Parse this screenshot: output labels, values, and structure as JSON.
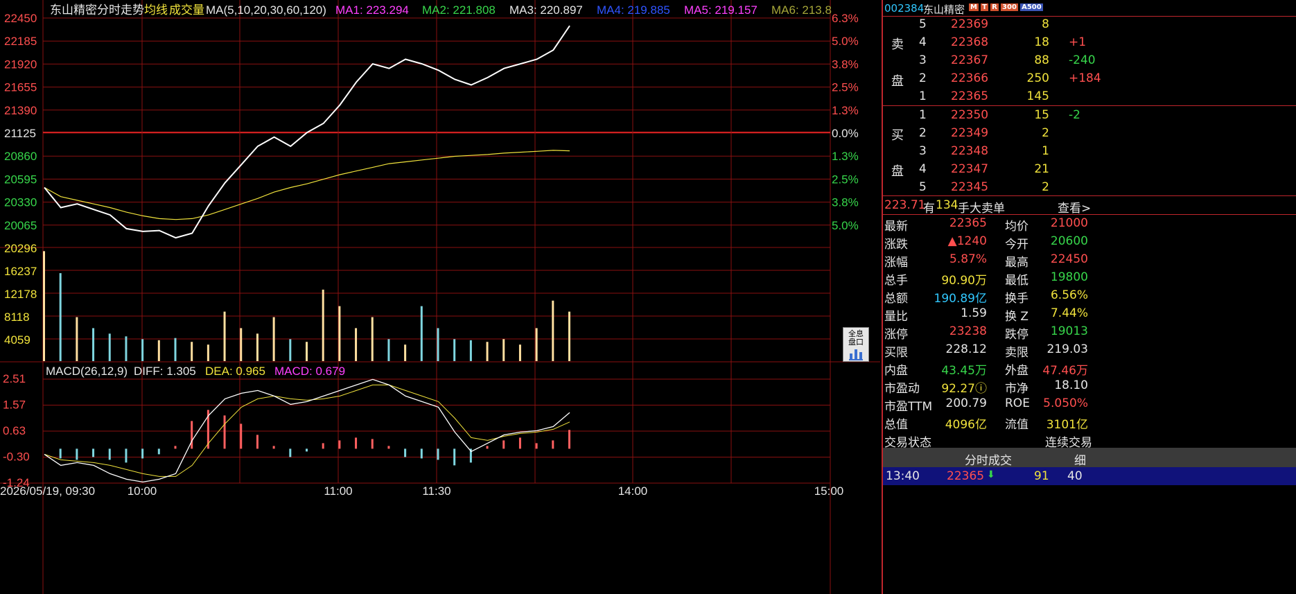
{
  "chart": {
    "title": "东山精密分时走势",
    "mode_avg": "均线",
    "mode_vol": "成交量",
    "ma_label": "MA(5,10,20,30,60,120)",
    "ma1": "MA1: 223.294",
    "ma2": "MA2: 221.808",
    "ma3": "MA3: 220.897",
    "ma4": "MA4: 219.885",
    "ma5": "MA5: 219.157",
    "ma6": "MA6: 213.8",
    "price_ticks": [
      "22450",
      "22185",
      "21920",
      "21655",
      "21390",
      "21125",
      "20860",
      "20595",
      "20330",
      "20065"
    ],
    "pct_ticks": [
      "6.3%",
      "5.0%",
      "3.8%",
      "2.5%",
      "1.3%",
      "0.0%",
      "1.3%",
      "2.5%",
      "3.8%",
      "5.0%"
    ],
    "vol_ticks": [
      "20296",
      "16237",
      "12178",
      "8118",
      "4059"
    ],
    "macd_label": "MACD(26,12,9)",
    "diff": "DIFF: 1.305",
    "dea": "DEA: 0.965",
    "macd": "MACD: 0.679",
    "macd_ticks": [
      "2.51",
      "1.57",
      "0.63",
      "-0.30",
      "-1.24"
    ],
    "date": "2026/05/19, 09:30",
    "time_ticks": [
      "10:00",
      "11:00",
      "11:30",
      "14:00",
      "15:00"
    ],
    "tool_button": "全息盘口",
    "colors": {
      "grid": "#8a1010",
      "price_line": "#ffffff",
      "avg_line": "#f1e33c",
      "up": "#ff4f4f",
      "down": "#7fd6e0"
    }
  },
  "chart_data": {
    "type": "line",
    "price_series": {
      "x": [
        "09:30",
        "09:35",
        "09:40",
        "09:45",
        "09:50",
        "09:55",
        "10:00",
        "10:05",
        "10:10",
        "10:15",
        "10:20",
        "10:25",
        "10:30",
        "10:35",
        "10:40",
        "10:45",
        "10:50",
        "10:55",
        "11:00",
        "11:05",
        "11:10",
        "11:15",
        "11:20",
        "11:25",
        "11:30",
        "13:05",
        "13:10",
        "13:15",
        "13:20",
        "13:25",
        "13:30",
        "13:35",
        "13:40"
      ],
      "price": [
        20600,
        20380,
        20420,
        20360,
        20300,
        20150,
        20120,
        20130,
        20050,
        20100,
        20400,
        20650,
        20850,
        21050,
        21150,
        21050,
        21200,
        21300,
        21500,
        21750,
        21950,
        21900,
        22000,
        21950,
        21880,
        21780,
        21720,
        21800,
        21900,
        21950,
        22000,
        22100,
        22365
      ],
      "avg": [
        20600,
        20500,
        20460,
        20420,
        20380,
        20330,
        20290,
        20260,
        20250,
        20260,
        20300,
        20360,
        20420,
        20480,
        20550,
        20600,
        20640,
        20690,
        20740,
        20780,
        20820,
        20860,
        20880,
        20900,
        20920,
        20940,
        20950,
        20960,
        20975,
        20985,
        20995,
        21005,
        21000
      ]
    },
    "volume": [
      20000,
      16000,
      8000,
      6000,
      5000,
      4500,
      4000,
      3800,
      4200,
      3500,
      3000,
      9000,
      6000,
      5000,
      8000,
      4000,
      3500,
      13000,
      10000,
      6000,
      8000,
      4000,
      3000,
      10000,
      6000,
      4000,
      3800,
      3500,
      4000,
      3000,
      6000,
      11000,
      9000
    ],
    "macd": {
      "diff": [
        -0.2,
        -0.6,
        -0.5,
        -0.6,
        -0.9,
        -1.1,
        -1.2,
        -1.1,
        -0.9,
        0.3,
        1.2,
        1.8,
        2.0,
        2.1,
        1.9,
        1.6,
        1.7,
        1.9,
        2.1,
        2.3,
        2.5,
        2.3,
        1.9,
        1.7,
        1.5,
        0.6,
        -0.1,
        0.2,
        0.5,
        0.6,
        0.65,
        0.8,
        1.305
      ],
      "dea": [
        -0.2,
        -0.4,
        -0.45,
        -0.5,
        -0.6,
        -0.75,
        -0.9,
        -1.0,
        -1.0,
        -0.6,
        0.2,
        0.9,
        1.5,
        1.8,
        1.9,
        1.8,
        1.75,
        1.8,
        1.9,
        2.1,
        2.3,
        2.3,
        2.1,
        1.9,
        1.7,
        1.1,
        0.4,
        0.3,
        0.45,
        0.55,
        0.6,
        0.7,
        0.965
      ],
      "hist": [
        0,
        -0.35,
        -0.4,
        -0.3,
        -0.4,
        -0.5,
        -0.35,
        -0.2,
        0.1,
        1.0,
        1.4,
        1.2,
        0.9,
        0.5,
        0.1,
        -0.3,
        -0.1,
        0.2,
        0.3,
        0.4,
        0.35,
        0.1,
        -0.3,
        -0.35,
        -0.4,
        -0.6,
        -0.5,
        0.1,
        0.3,
        0.4,
        0.2,
        0.3,
        0.679
      ]
    },
    "price_range": [
      19945,
      22450
    ],
    "volume_range": [
      0,
      20296
    ],
    "macd_range": [
      -1.24,
      2.51
    ]
  },
  "quote": {
    "code": "002384",
    "name": "东山精密",
    "badges": [
      "M",
      "T",
      "R",
      "300",
      "A500"
    ],
    "sell_label": "卖",
    "buy_label": "买",
    "pan_label": "盘",
    "sell": [
      {
        "lvl": "5",
        "price": "22369",
        "vol": "8",
        "chg": ""
      },
      {
        "lvl": "4",
        "price": "22368",
        "vol": "18",
        "chg": "+1"
      },
      {
        "lvl": "3",
        "price": "22367",
        "vol": "88",
        "chg": "-240"
      },
      {
        "lvl": "2",
        "price": "22366",
        "vol": "250",
        "chg": "+184"
      },
      {
        "lvl": "1",
        "price": "22365",
        "vol": "145",
        "chg": ""
      }
    ],
    "buy": [
      {
        "lvl": "1",
        "price": "22350",
        "vol": "15",
        "chg": "-2"
      },
      {
        "lvl": "2",
        "price": "22349",
        "vol": "2",
        "chg": ""
      },
      {
        "lvl": "3",
        "price": "22348",
        "vol": "1",
        "chg": ""
      },
      {
        "lvl": "4",
        "price": "22347",
        "vol": "21",
        "chg": ""
      },
      {
        "lvl": "5",
        "price": "22345",
        "vol": "2",
        "chg": ""
      }
    ],
    "bigorder_a": "223.71",
    "bigorder_b": "有",
    "bigorder_c": "134",
    "bigorder_d": "手大卖单",
    "view_link": "查看>",
    "stats": [
      {
        "k1": "最新",
        "v1": "22365",
        "k2": "均价",
        "v2": "21000",
        "c1": "r",
        "c2": "r"
      },
      {
        "k1": "涨跌",
        "v1": "▲1240",
        "k2": "今开",
        "v2": "20600",
        "c1": "r",
        "c2": "g"
      },
      {
        "k1": "涨幅",
        "v1": "5.87%",
        "k2": "最高",
        "v2": "22450",
        "c1": "r",
        "c2": "r"
      },
      {
        "k1": "总手",
        "v1": "90.90万",
        "k2": "最低",
        "v2": "19800",
        "c1": "y",
        "c2": "g"
      },
      {
        "k1": "总额",
        "v1": "190.89亿",
        "k2": "换手",
        "v2": "6.56%",
        "c1": "c",
        "c2": "y"
      },
      {
        "k1": "量比",
        "v1": "1.59",
        "k2": "换 Z",
        "v2": "7.44%",
        "c1": "w",
        "c2": "y"
      },
      {
        "k1": "涨停",
        "v1": "23238",
        "k2": "跌停",
        "v2": "19013",
        "c1": "r",
        "c2": "g"
      },
      {
        "k1": "买限",
        "v1": "228.12",
        "k2": "卖限",
        "v2": "219.03",
        "c1": "w",
        "c2": "w"
      },
      {
        "k1": "内盘",
        "v1": "43.45万",
        "k2": "外盘",
        "v2": "47.46万",
        "c1": "g",
        "c2": "r"
      },
      {
        "k1": "市盈动",
        "v1": "92.27ⓘ",
        "k2": "市净",
        "v2": "18.10",
        "c1": "y",
        "c2": "w"
      },
      {
        "k1": "市盈TTM",
        "v1": "200.79",
        "k2": "ROE",
        "v2": "5.050%",
        "c1": "w",
        "c2": "r"
      },
      {
        "k1": "总值",
        "v1": "4096亿",
        "k2": "流值",
        "v2": "3101亿",
        "c1": "y",
        "c2": "y"
      }
    ],
    "trade_status_label": "交易状态",
    "trade_status_value": "连续交易",
    "ticks_title": "分时成交",
    "ticks_tab": "细",
    "tick_time": "13:40",
    "tick_price": "22365",
    "tick_vol": "91",
    "tick_count": "40"
  }
}
